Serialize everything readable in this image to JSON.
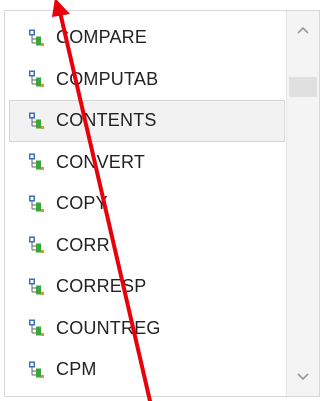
{
  "list": {
    "items": [
      {
        "label": "COMPARE",
        "selected": false
      },
      {
        "label": "COMPUTAB",
        "selected": false
      },
      {
        "label": "CONTENTS",
        "selected": true
      },
      {
        "label": "CONVERT",
        "selected": false
      },
      {
        "label": "COPY",
        "selected": false
      },
      {
        "label": "CORR",
        "selected": false
      },
      {
        "label": "CORRESP",
        "selected": false
      },
      {
        "label": "COUNTREG",
        "selected": false
      },
      {
        "label": "CPM",
        "selected": false
      }
    ],
    "item_icon": "procedure-node-icon"
  },
  "scrollbar": {
    "up_icon": "chevron-up-icon",
    "down_icon": "chevron-down-icon"
  },
  "colors": {
    "annotation_arrow": "#e8000b",
    "selected_bg": "#f2f2f2",
    "icon_blue": "#3b6fb6",
    "icon_green": "#3aa53a"
  }
}
